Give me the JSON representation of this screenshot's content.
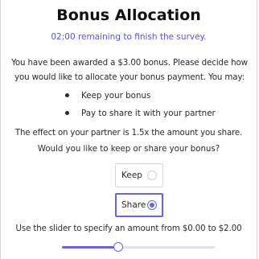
{
  "survey": {
    "title": "Bonus Allocation",
    "timer_text": "02:00 remaining to finish the survey.",
    "intro_text": "You have been awarded a $3.00 bonus. Please decide how you would like to allocate your bonus payment. You may:",
    "options_list": [
      "Keep your bonus",
      "Pay to share it with your partner"
    ],
    "effect_text": "The effect on your partner is 1.5x the amount you share.",
    "question_text": "Would you like to keep or share your bonus?",
    "choices": [
      {
        "label": "Keep",
        "selected": false
      },
      {
        "label": "Share",
        "selected": true
      }
    ],
    "slider_instruction": "Use the slider to specify an amount from $0.00 to $2.00",
    "slider": {
      "min": 0,
      "max": 2,
      "value": 0.74
    }
  },
  "colors": {
    "accent": "#6a63e0",
    "timer": "#5a55d6"
  }
}
